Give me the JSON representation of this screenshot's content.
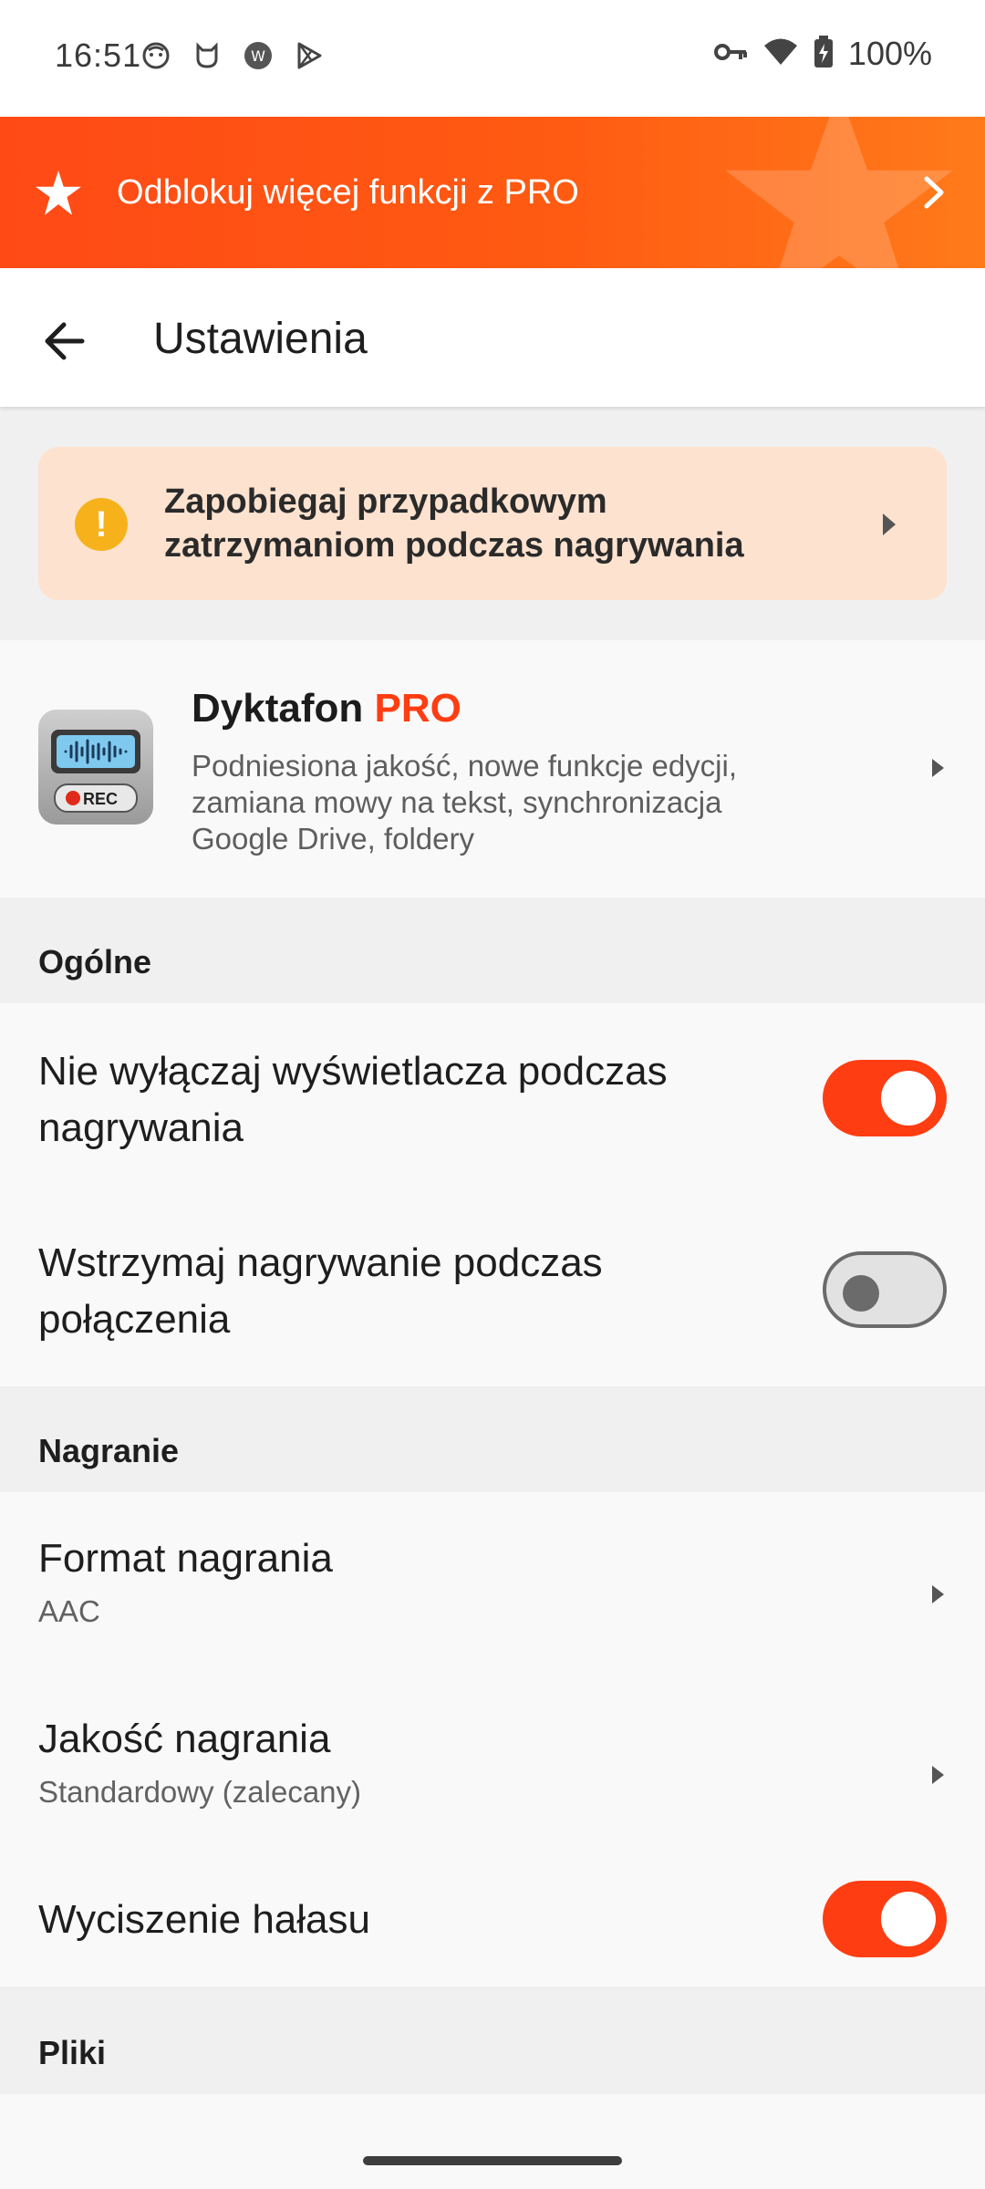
{
  "status_bar": {
    "time": "16:51",
    "battery": "100%"
  },
  "promo": {
    "text": "Odblokuj więcej funkcji z PRO"
  },
  "appbar": {
    "title": "Ustawienia"
  },
  "warning": {
    "line1": "Zapobiegaj przypadkowym",
    "line2": "zatrzymaniom podczas nagrywania"
  },
  "pro_card": {
    "name": "Dyktafon",
    "name_suffix": "PRO",
    "desc_line1": "Podniesiona jakość, nowe funkcje edycji,",
    "desc_line2": "zamiana mowy na tekst, synchronizacja",
    "desc_line3": "Google Drive, foldery",
    "icon_label": "REC"
  },
  "general": {
    "header": "Ogólne",
    "keep_screen_line1": "Nie wyłączaj wyświetlacza podczas",
    "keep_screen_line2": "nagrywania",
    "keep_screen_on": true,
    "pause_call_line1": "Wstrzymaj nagrywanie podczas",
    "pause_call_line2": "połączenia",
    "pause_call_on": false
  },
  "recording": {
    "header": "Nagranie",
    "format_title": "Format nagrania",
    "format_value": "AAC",
    "quality_title": "Jakość nagrania",
    "quality_value": "Standardowy (zalecany)",
    "noise_title": "Wyciszenie hałasu",
    "noise_on": true
  },
  "files": {
    "header": "Pliki"
  },
  "colors": {
    "accent": "#ff3d12",
    "warning_bg": "#fde2cf",
    "warning_icon": "#f7b21b"
  }
}
